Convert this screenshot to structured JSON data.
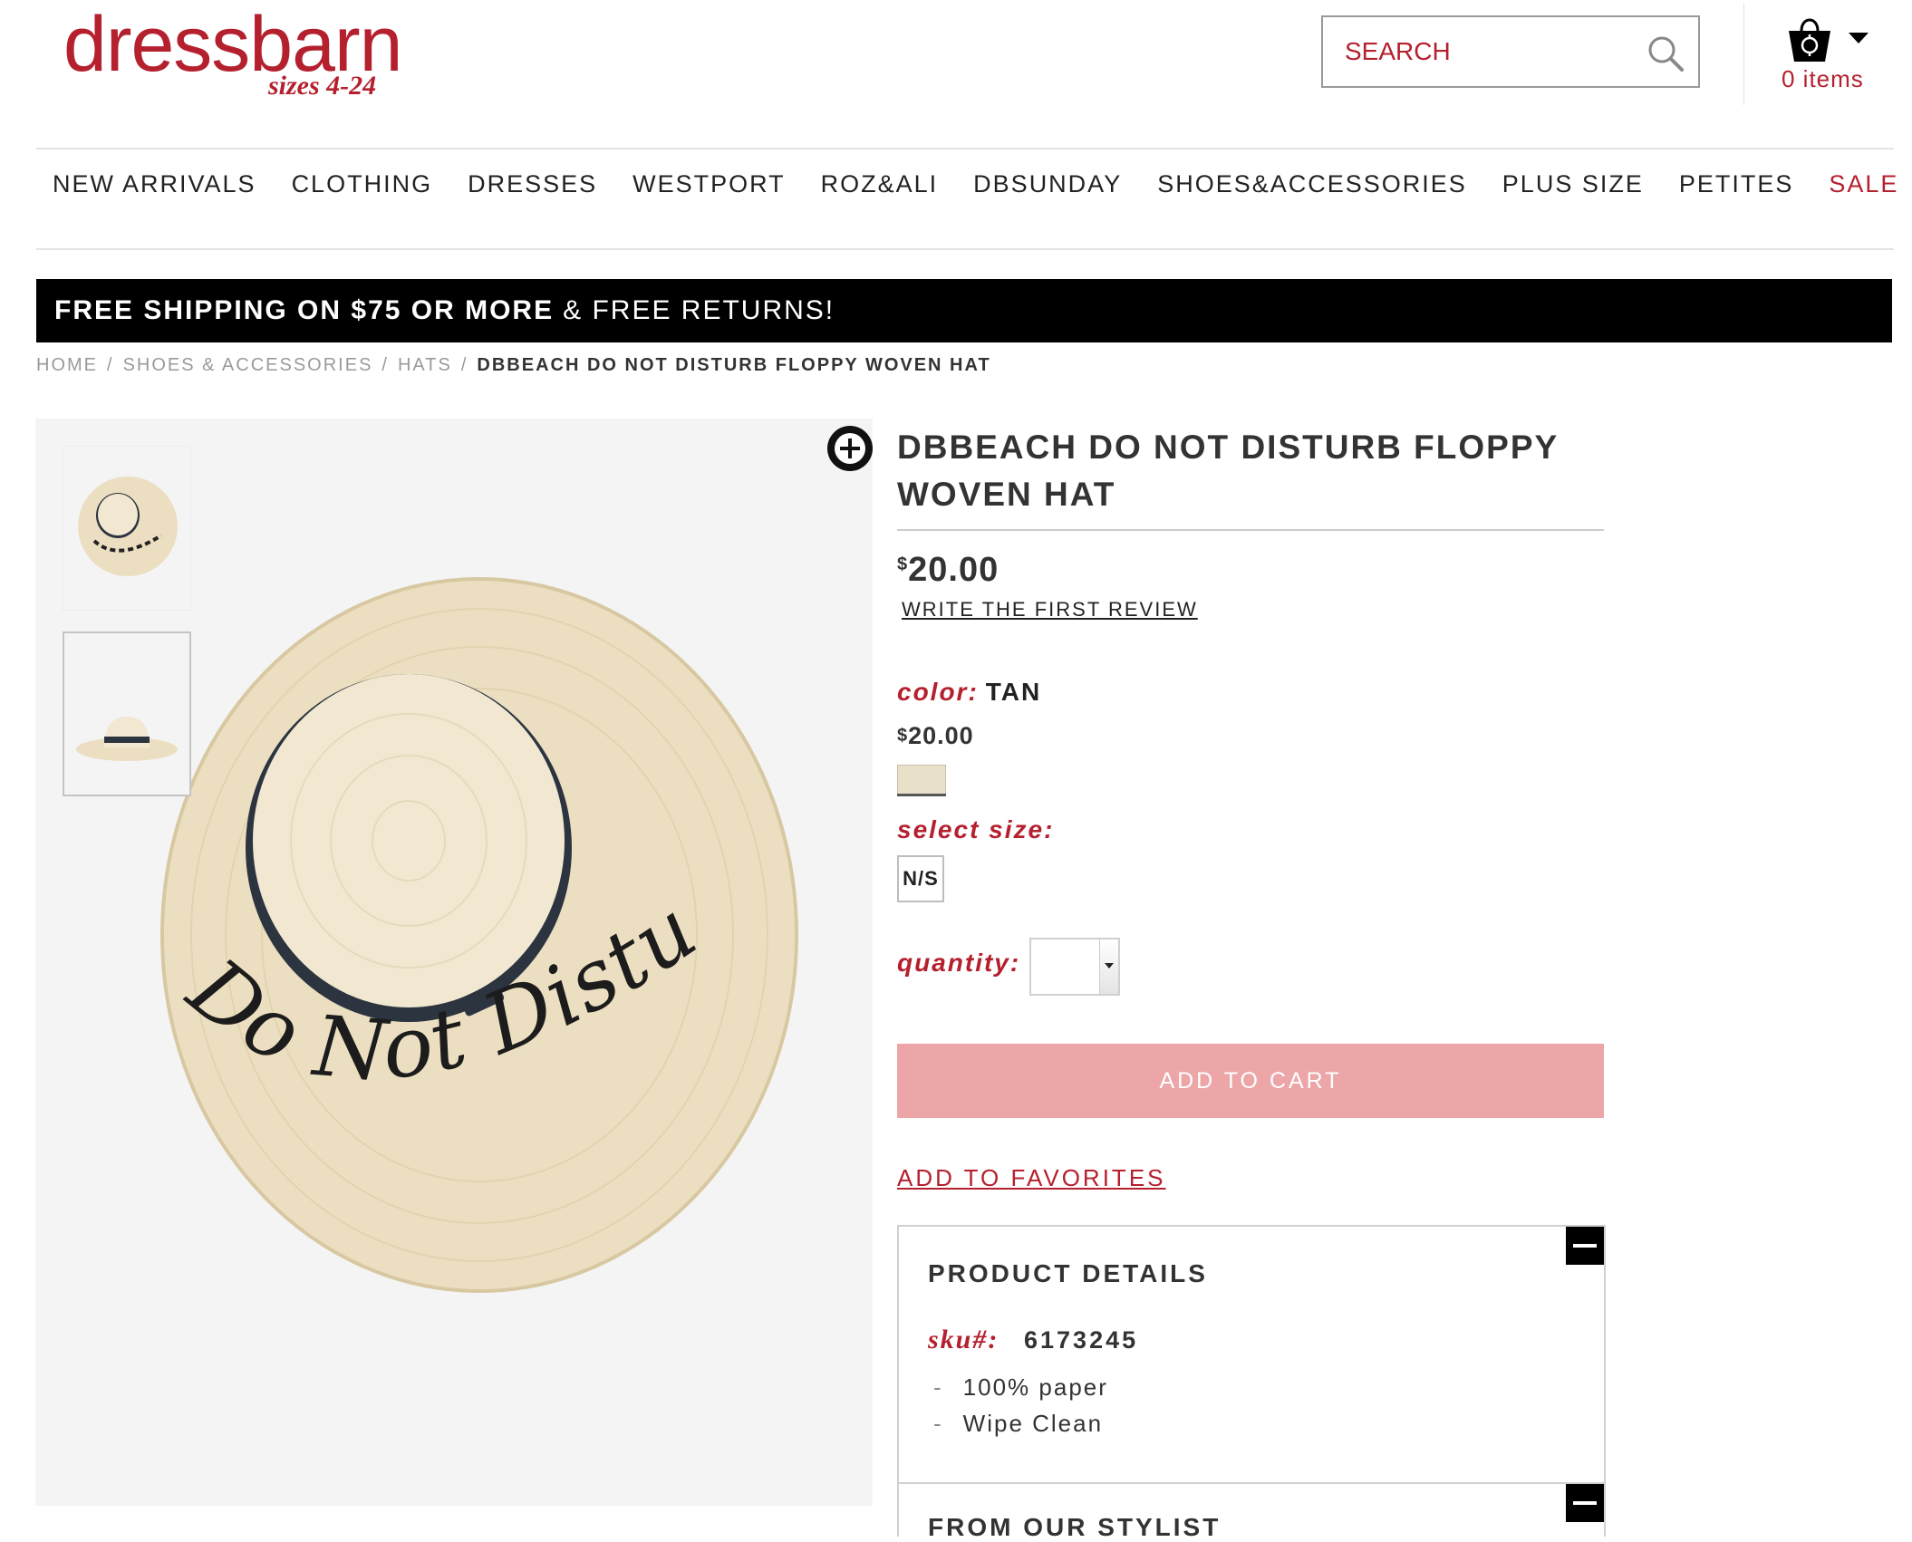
{
  "brand": {
    "name": "dressbarn",
    "tagline": "sizes 4-24"
  },
  "search": {
    "placeholder": "SEARCH",
    "icon": "search-icon"
  },
  "cart": {
    "count_label": "0 items",
    "icon": "shopping-bag-icon"
  },
  "nav": {
    "items": [
      "NEW ARRIVALS",
      "CLOTHING",
      "DRESSES",
      "WESTPORT",
      "ROZ&ALI",
      "DBSUNDAY",
      "SHOES&ACCESSORIES",
      "PLUS SIZE",
      "PETITES",
      "SALE"
    ]
  },
  "promo": {
    "bold": "FREE SHIPPING ON $75 OR MORE",
    "light": "& FREE RETURNS!"
  },
  "breadcrumb": {
    "items": [
      "HOME",
      "SHOES & ACCESSORIES",
      "HATS"
    ],
    "separator": "/",
    "current": "DBBEACH DO NOT DISTURB FLOPPY WOVEN HAT"
  },
  "product": {
    "title_line1": "DBBEACH DO NOT DISTURB FLOPPY",
    "title_line2": "WOVEN HAT",
    "currency": "$",
    "price": "20.00",
    "review_link": "WRITE THE FIRST REVIEW",
    "color_label": "color:",
    "color_value": "TAN",
    "variant_price": "20.00",
    "swatch_color": "#e9e0c9",
    "size_label": "select size:",
    "size_option": "N/S",
    "quantity_label": "quantity:",
    "quantity_value": "",
    "add_to_cart": "ADD TO CART",
    "add_to_favorites": "ADD TO FAVORITES",
    "hat_text": "Do Not Disturb"
  },
  "details": {
    "heading": "PRODUCT DETAILS",
    "sku_label": "sku#:",
    "sku_value": "6173245",
    "features": [
      "100% paper",
      "Wipe Clean"
    ],
    "stylist_heading": "FROM OUR STYLIST"
  },
  "colors": {
    "brand_red": "#b5202e",
    "add_to_cart_bg": "#eca6a8",
    "promo_bg": "#000000"
  }
}
